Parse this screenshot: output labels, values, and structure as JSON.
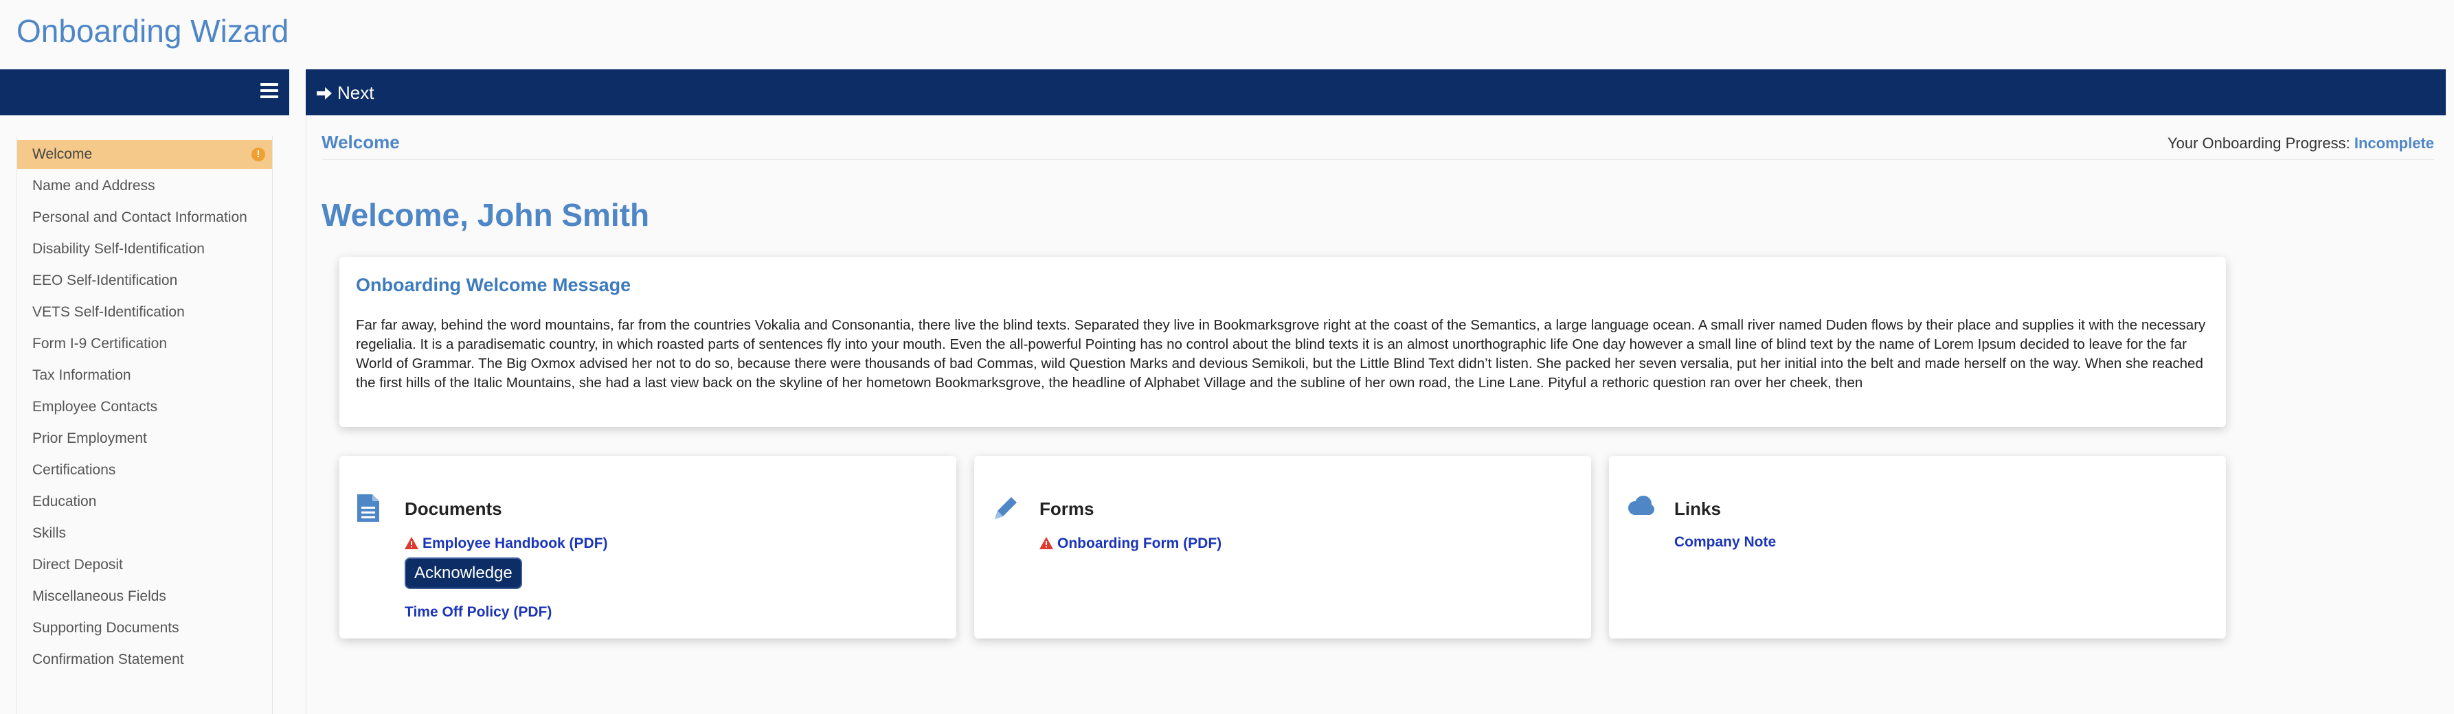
{
  "app": {
    "title": "Onboarding Wizard"
  },
  "toolbar": {
    "next_label": "Next",
    "menu_icon": "hamburger-icon",
    "next_icon": "arrow-right-icon"
  },
  "colors": {
    "primary": "#0d2d66",
    "accent": "#4f86c6",
    "active_item": "#f4c98a",
    "warning": "#e03a2f",
    "link": "#1a35b8"
  },
  "sidebar": {
    "items": [
      {
        "label": "Welcome",
        "active": true,
        "warning": "!"
      },
      {
        "label": "Name and Address"
      },
      {
        "label": "Personal and Contact Information"
      },
      {
        "label": "Disability Self-Identification"
      },
      {
        "label": "EEO Self-Identification"
      },
      {
        "label": "VETS Self-Identification"
      },
      {
        "label": "Form I-9 Certification"
      },
      {
        "label": "Tax Information"
      },
      {
        "label": "Employee Contacts"
      },
      {
        "label": "Prior Employment"
      },
      {
        "label": "Certifications"
      },
      {
        "label": "Education"
      },
      {
        "label": "Skills"
      },
      {
        "label": "Direct Deposit"
      },
      {
        "label": "Miscellaneous Fields"
      },
      {
        "label": "Supporting Documents"
      },
      {
        "label": "Confirmation Statement"
      }
    ]
  },
  "main": {
    "breadcrumb": "Welcome",
    "progress_label": "Your Onboarding Progress: ",
    "progress_status": "Incomplete",
    "heading": "Welcome, John Smith",
    "message": {
      "title": "Onboarding Welcome Message",
      "body": "Far far away, behind the word mountains, far from the countries Vokalia and Consonantia, there live the blind texts. Separated they live in Bookmarksgrove right at the coast of the Semantics, a large language ocean. A small river named Duden flows by their place and supplies it with the necessary regelialia. It is a paradisematic country, in which roasted parts of sentences fly into your mouth. Even the all-powerful Pointing has no control about the blind texts it is an almost unorthographic life One day however a small line of blind text by the name of Lorem Ipsum decided to leave for the far World of Grammar. The Big Oxmox advised her not to do so, because there were thousands of bad Commas, wild Question Marks and devious Semikoli, but the Little Blind Text didn’t listen. She packed her seven versalia, put her initial into the belt and made herself on the way. When she reached the first hills of the Italic Mountains, she had a last view back on the skyline of her hometown Bookmarksgrove, the headline of Alphabet Village and the subline of her own road, the Line Lane. Pityful a rethoric question ran over her cheek, then"
    },
    "panels": {
      "documents": {
        "title": "Documents",
        "icon": "document-icon",
        "links": [
          "Employee Handbook (PDF)",
          "Time Off Policy (PDF)"
        ],
        "acknowledge_label": "Acknowledge"
      },
      "forms": {
        "title": "Forms",
        "icon": "pencil-icon",
        "links": [
          "Onboarding Form (PDF)"
        ]
      },
      "links": {
        "title": "Links",
        "icon": "cloud-icon",
        "links": [
          "Company Note"
        ]
      }
    }
  }
}
